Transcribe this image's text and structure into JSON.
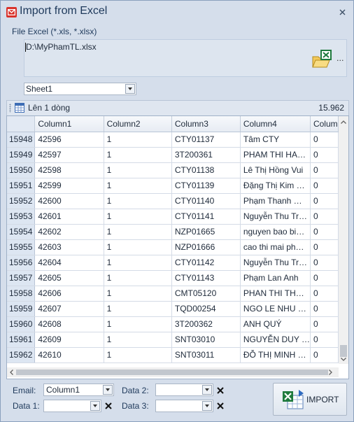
{
  "window": {
    "title": "Import from Excel"
  },
  "file": {
    "label": "File Excel (*.xls, *.xlsx)",
    "path": "D:\\MyPhamTL.xlsx",
    "browse_label": "..."
  },
  "sheet": {
    "selected": "Sheet1"
  },
  "toolbar": {
    "move_up_label": "Lên 1 dòng",
    "row_count": "15.962"
  },
  "grid": {
    "columns": [
      "Column1",
      "Column2",
      "Column3",
      "Column4",
      "Colum"
    ],
    "rows": [
      {
        "num": "15948",
        "c1": "42596",
        "c2": "1",
        "c3": "CTY01137",
        "c4": "Tâm CTY",
        "c5": "0"
      },
      {
        "num": "15949",
        "c1": "42597",
        "c2": "1",
        "c3": "3T200361",
        "c4": "PHAM THI HA…",
        "c5": "0"
      },
      {
        "num": "15950",
        "c1": "42598",
        "c2": "1",
        "c3": "CTY01138",
        "c4": "Lê Thị Hồng Vui",
        "c5": "0"
      },
      {
        "num": "15951",
        "c1": "42599",
        "c2": "1",
        "c3": "CTY01139",
        "c4": "Đặng Thị Kim …",
        "c5": "0"
      },
      {
        "num": "15952",
        "c1": "42600",
        "c2": "1",
        "c3": "CTY01140",
        "c4": "Phạm Thanh …",
        "c5": "0"
      },
      {
        "num": "15953",
        "c1": "42601",
        "c2": "1",
        "c3": "CTY01141",
        "c4": "Nguyễn Thu Tr…",
        "c5": "0"
      },
      {
        "num": "15954",
        "c1": "42602",
        "c2": "1",
        "c3": "NZP01665",
        "c4": "nguyen bao bi…",
        "c5": "0"
      },
      {
        "num": "15955",
        "c1": "42603",
        "c2": "1",
        "c3": "NZP01666",
        "c4": "cao thi mai ph…",
        "c5": "0"
      },
      {
        "num": "15956",
        "c1": "42604",
        "c2": "1",
        "c3": "CTY01142",
        "c4": "Nguyễn Thu Tr…",
        "c5": "0"
      },
      {
        "num": "15957",
        "c1": "42605",
        "c2": "1",
        "c3": "CTY01143",
        "c4": "Phạm Lan Anh",
        "c5": "0"
      },
      {
        "num": "15958",
        "c1": "42606",
        "c2": "1",
        "c3": "CMT05120",
        "c4": "PHAN THI TH…",
        "c5": "0"
      },
      {
        "num": "15959",
        "c1": "42607",
        "c2": "1",
        "c3": "TQD00254",
        "c4": "NGO LE NHU …",
        "c5": "0"
      },
      {
        "num": "15960",
        "c1": "42608",
        "c2": "1",
        "c3": "3T200362",
        "c4": "ANH QUÝ",
        "c5": "0"
      },
      {
        "num": "15961",
        "c1": "42609",
        "c2": "1",
        "c3": "SNT03010",
        "c4": "NGUYỄN DUY …",
        "c5": "0"
      },
      {
        "num": "15962",
        "c1": "42610",
        "c2": "1",
        "c3": "SNT03011",
        "c4": "ĐỖ THỊ MINH …",
        "c5": "0"
      }
    ]
  },
  "mapping": {
    "email_label": "Email:",
    "email_value": "Column1",
    "data1_label": "Data 1:",
    "data1_value": "",
    "data2_label": "Data 2:",
    "data2_value": "",
    "data3_label": "Data 3:",
    "data3_value": ""
  },
  "import_button": {
    "label": "IMPORT"
  },
  "colors": {
    "title": "#1e395b",
    "window_bg": "#d5deeb",
    "row_header": "#dde6f2",
    "excel_green": "#1f7a3e"
  }
}
